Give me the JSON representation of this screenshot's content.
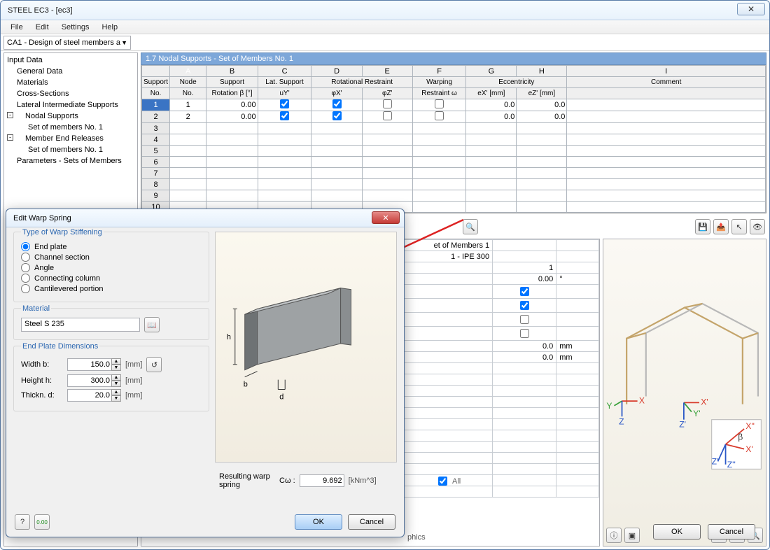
{
  "window": {
    "title": "STEEL EC3 - [ec3]",
    "menu": [
      "File",
      "Edit",
      "Settings",
      "Help"
    ],
    "combo": "CA1 - Design of steel members a",
    "close_glyph": "✕"
  },
  "tree": {
    "header": "Input Data",
    "items": [
      {
        "label": "General Data",
        "lvl": 1
      },
      {
        "label": "Materials",
        "lvl": 1
      },
      {
        "label": "Cross-Sections",
        "lvl": 1
      },
      {
        "label": "Lateral Intermediate Supports",
        "lvl": 1
      },
      {
        "label": "Nodal Supports",
        "lvl": 1,
        "exp": "-"
      },
      {
        "label": "Set of members No. 1",
        "lvl": 2
      },
      {
        "label": "Member End Releases",
        "lvl": 1,
        "exp": "-"
      },
      {
        "label": "Set of members No. 1",
        "lvl": 2
      },
      {
        "label": "Parameters - Sets of Members",
        "lvl": 1
      }
    ]
  },
  "grid": {
    "title": "1.7 Nodal Supports - Set of Members No. 1",
    "letters": [
      "A",
      "B",
      "C",
      "D",
      "E",
      "F",
      "G",
      "H",
      "I"
    ],
    "header1": [
      "Support",
      "Node",
      "Support",
      "Lat. Support",
      "Rotational Restraint",
      "",
      "Warping",
      "Eccentricity",
      "",
      "Comment"
    ],
    "header2": [
      "No.",
      "No.",
      "Rotation β [°]",
      "uY'",
      "φX'",
      "φZ'",
      "Restraint ω",
      "eX' [mm]",
      "eZ' [mm]",
      ""
    ],
    "rows": [
      {
        "no": "1",
        "node": "1",
        "rot": "0.00",
        "uy": true,
        "phix": true,
        "phiz": false,
        "warp": false,
        "ex": "0.0",
        "ez": "0.0"
      },
      {
        "no": "2",
        "node": "2",
        "rot": "0.00",
        "uy": true,
        "phix": true,
        "phiz": false,
        "warp": false,
        "ex": "0.0",
        "ez": "0.0"
      }
    ],
    "empty_rows": [
      "3",
      "4",
      "5",
      "6",
      "7",
      "8",
      "9",
      "10"
    ]
  },
  "details": {
    "setline": "et of Members 1",
    "csline": "1 - IPE 300",
    "rows": [
      {
        "v": "1",
        "u": ""
      },
      {
        "v": "0.00",
        "u": "°"
      },
      {
        "v": "",
        "u": "",
        "chk": true
      },
      {
        "v": "",
        "u": "",
        "chk": true
      },
      {
        "v": "",
        "u": "",
        "chk": false
      },
      {
        "v": "",
        "u": "",
        "chk": false
      },
      {
        "v": "0.0",
        "u": "mm"
      },
      {
        "v": "0.0",
        "u": "mm"
      }
    ],
    "all_label": "All"
  },
  "viewer": {
    "axes": [
      "X",
      "Y",
      "Z",
      "X'",
      "Y'",
      "Z'",
      "X''",
      "Z''",
      "β"
    ]
  },
  "dialog": {
    "title": "Edit Warp Spring",
    "group1": "Type of Warp Stiffening",
    "options": [
      "End plate",
      "Channel section",
      "Angle",
      "Connecting column",
      "Cantilevered portion"
    ],
    "group2": "Material",
    "material": "Steel S 235",
    "group3": "End Plate Dimensions",
    "fields": [
      {
        "label": "Width  b:",
        "value": "150.0",
        "unit": "[mm]",
        "btn": true
      },
      {
        "label": "Height h:",
        "value": "300.0",
        "unit": "[mm]",
        "btn": false
      },
      {
        "label": "Thickn. d:",
        "value": "20.0",
        "unit": "[mm]",
        "btn": false
      }
    ],
    "result_label": "Resulting warp spring",
    "result_sym": "Cω :",
    "result_value": "9.692",
    "result_unit": "[kNm^3]",
    "ok": "OK",
    "cancel": "Cancel",
    "diagram_labels": [
      "h",
      "b",
      "d"
    ]
  },
  "text": {
    "graphics_stub": "phics",
    "ok": "OK",
    "cancel": "Cancel"
  },
  "icons": {
    "zoom": "🔍",
    "save": "💾",
    "export": "📤",
    "pick": "↖",
    "eye": "👁",
    "info": "ⓘ",
    "cube": "▣",
    "dim1": "⇱",
    "dim2": "⇲",
    "mag": "🔍",
    "help": "?",
    "pref": "0.00",
    "lib": "📖",
    "reset": "↺"
  }
}
